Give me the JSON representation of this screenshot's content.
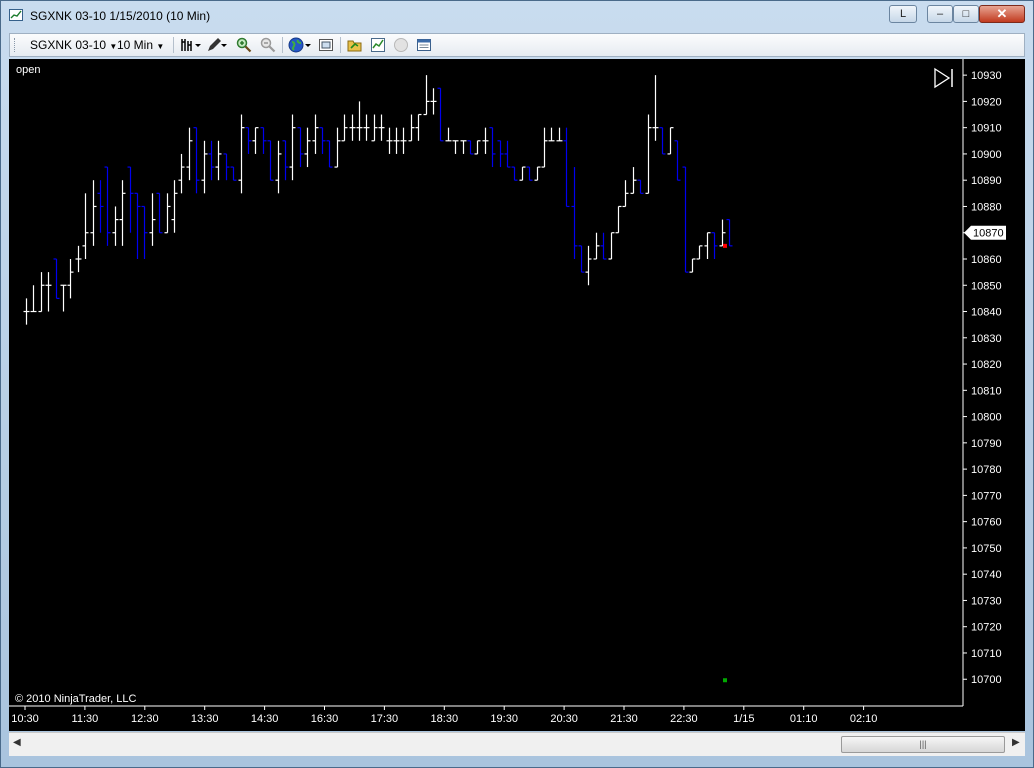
{
  "window": {
    "title": "SGXNK 03-10  1/15/2010 (10 Min)",
    "buttons": {
      "layout": "L",
      "minimize": "–",
      "maximize": "□",
      "close": "✕"
    }
  },
  "toolbar": {
    "instrument": "SGXNK 03-10",
    "interval": "10 Min",
    "icons": [
      "bar-type-icon",
      "drawing-pencil-icon",
      "zoom-in-icon",
      "zoom-out-icon",
      "globe-icon",
      "properties-icon",
      "open-folder-icon",
      "chart-indicators-icon",
      "blank-circle-icon",
      "data-box-icon"
    ]
  },
  "chart": {
    "plot_label": "open",
    "copyright": "© 2010 NinjaTrader, LLC",
    "price_label": "10870",
    "colors": {
      "background": "#000000",
      "up_bar": "#ffffff",
      "down_bar": "#0000ee",
      "marker_red": "#ff0000",
      "marker_green": "#00aa00"
    }
  },
  "chart_data": {
    "type": "ohlc",
    "y_ticks": [
      10930,
      10920,
      10910,
      10900,
      10890,
      10880,
      10870,
      10860,
      10850,
      10840,
      10830,
      10820,
      10810,
      10800,
      10790,
      10780,
      10770,
      10760,
      10750,
      10740,
      10730,
      10720,
      10710,
      10700
    ],
    "ylim": [
      10694,
      10935
    ],
    "x_ticks": [
      "10:30",
      "11:30",
      "12:30",
      "13:30",
      "14:30",
      "16:30",
      "17:30",
      "18:30",
      "19:30",
      "20:30",
      "21:30",
      "22:30",
      "1/15",
      "01:10",
      "02:10"
    ],
    "current_price": 10870,
    "bars": [
      {
        "o": 10840,
        "h": 10845,
        "l": 10835,
        "c": 10840
      },
      {
        "o": 10840,
        "h": 10850,
        "l": 10840,
        "c": 10840
      },
      {
        "o": 10840,
        "h": 10855,
        "l": 10840,
        "c": 10850
      },
      {
        "o": 10850,
        "h": 10855,
        "l": 10840,
        "c": 10850
      },
      {
        "o": 10860,
        "h": 10860,
        "l": 10845,
        "c": 10845
      },
      {
        "o": 10850,
        "h": 10850,
        "l": 10840,
        "c": 10850
      },
      {
        "o": 10850,
        "h": 10860,
        "l": 10845,
        "c": 10855
      },
      {
        "o": 10860,
        "h": 10865,
        "l": 10855,
        "c": 10860
      },
      {
        "o": 10865,
        "h": 10885,
        "l": 10860,
        "c": 10870
      },
      {
        "o": 10870,
        "h": 10890,
        "l": 10865,
        "c": 10880
      },
      {
        "o": 10885,
        "h": 10890,
        "l": 10870,
        "c": 10880
      },
      {
        "o": 10895,
        "h": 10895,
        "l": 10865,
        "c": 10870
      },
      {
        "o": 10870,
        "h": 10880,
        "l": 10865,
        "c": 10875
      },
      {
        "o": 10875,
        "h": 10890,
        "l": 10865,
        "c": 10885
      },
      {
        "o": 10895,
        "h": 10895,
        "l": 10870,
        "c": 10885
      },
      {
        "o": 10885,
        "h": 10885,
        "l": 10860,
        "c": 10880
      },
      {
        "o": 10880,
        "h": 10880,
        "l": 10860,
        "c": 10870
      },
      {
        "o": 10870,
        "h": 10885,
        "l": 10865,
        "c": 10875
      },
      {
        "o": 10885,
        "h": 10885,
        "l": 10870,
        "c": 10870
      },
      {
        "o": 10870,
        "h": 10885,
        "l": 10870,
        "c": 10880
      },
      {
        "o": 10875,
        "h": 10890,
        "l": 10870,
        "c": 10885
      },
      {
        "o": 10890,
        "h": 10900,
        "l": 10885,
        "c": 10895
      },
      {
        "o": 10895,
        "h": 10910,
        "l": 10890,
        "c": 10905
      },
      {
        "o": 10910,
        "h": 10910,
        "l": 10885,
        "c": 10890
      },
      {
        "o": 10890,
        "h": 10905,
        "l": 10885,
        "c": 10900
      },
      {
        "o": 10900,
        "h": 10905,
        "l": 10890,
        "c": 10895
      },
      {
        "o": 10895,
        "h": 10905,
        "l": 10890,
        "c": 10900
      },
      {
        "o": 10900,
        "h": 10900,
        "l": 10890,
        "c": 10895
      },
      {
        "o": 10895,
        "h": 10895,
        "l": 10890,
        "c": 10890
      },
      {
        "o": 10890,
        "h": 10915,
        "l": 10885,
        "c": 10910
      },
      {
        "o": 10910,
        "h": 10910,
        "l": 10900,
        "c": 10905
      },
      {
        "o": 10905,
        "h": 10910,
        "l": 10900,
        "c": 10910
      },
      {
        "o": 10910,
        "h": 10910,
        "l": 10900,
        "c": 10905
      },
      {
        "o": 10905,
        "h": 10905,
        "l": 10890,
        "c": 10890
      },
      {
        "o": 10890,
        "h": 10905,
        "l": 10885,
        "c": 10900
      },
      {
        "o": 10905,
        "h": 10905,
        "l": 10890,
        "c": 10895
      },
      {
        "o": 10895,
        "h": 10915,
        "l": 10890,
        "c": 10910
      },
      {
        "o": 10910,
        "h": 10910,
        "l": 10895,
        "c": 10900
      },
      {
        "o": 10900,
        "h": 10910,
        "l": 10895,
        "c": 10905
      },
      {
        "o": 10905,
        "h": 10915,
        "l": 10900,
        "c": 10910
      },
      {
        "o": 10910,
        "h": 10910,
        "l": 10900,
        "c": 10905
      },
      {
        "o": 10905,
        "h": 10905,
        "l": 10895,
        "c": 10895
      },
      {
        "o": 10895,
        "h": 10910,
        "l": 10895,
        "c": 10905
      },
      {
        "o": 10905,
        "h": 10915,
        "l": 10905,
        "c": 10910
      },
      {
        "o": 10910,
        "h": 10915,
        "l": 10905,
        "c": 10910
      },
      {
        "o": 10910,
        "h": 10920,
        "l": 10905,
        "c": 10910
      },
      {
        "o": 10910,
        "h": 10915,
        "l": 10905,
        "c": 10910
      },
      {
        "o": 10905,
        "h": 10915,
        "l": 10905,
        "c": 10910
      },
      {
        "o": 10910,
        "h": 10915,
        "l": 10905,
        "c": 10910
      },
      {
        "o": 10905,
        "h": 10910,
        "l": 10900,
        "c": 10905
      },
      {
        "o": 10905,
        "h": 10910,
        "l": 10900,
        "c": 10905
      },
      {
        "o": 10905,
        "h": 10910,
        "l": 10900,
        "c": 10905
      },
      {
        "o": 10905,
        "h": 10915,
        "l": 10905,
        "c": 10910
      },
      {
        "o": 10910,
        "h": 10915,
        "l": 10905,
        "c": 10915
      },
      {
        "o": 10915,
        "h": 10930,
        "l": 10915,
        "c": 10920
      },
      {
        "o": 10920,
        "h": 10925,
        "l": 10915,
        "c": 10920
      },
      {
        "o": 10925,
        "h": 10925,
        "l": 10905,
        "c": 10905
      },
      {
        "o": 10905,
        "h": 10910,
        "l": 10905,
        "c": 10905
      },
      {
        "o": 10905,
        "h": 10905,
        "l": 10900,
        "c": 10905
      },
      {
        "o": 10905,
        "h": 10905,
        "l": 10900,
        "c": 10905
      },
      {
        "o": 10905,
        "h": 10905,
        "l": 10900,
        "c": 10900
      },
      {
        "o": 10900,
        "h": 10905,
        "l": 10900,
        "c": 10905
      },
      {
        "o": 10905,
        "h": 10910,
        "l": 10900,
        "c": 10905
      },
      {
        "o": 10910,
        "h": 10910,
        "l": 10895,
        "c": 10900
      },
      {
        "o": 10905,
        "h": 10905,
        "l": 10895,
        "c": 10900
      },
      {
        "o": 10900,
        "h": 10905,
        "l": 10895,
        "c": 10895
      },
      {
        "o": 10895,
        "h": 10895,
        "l": 10890,
        "c": 10890
      },
      {
        "o": 10890,
        "h": 10895,
        "l": 10890,
        "c": 10895
      },
      {
        "o": 10895,
        "h": 10895,
        "l": 10890,
        "c": 10890
      },
      {
        "o": 10890,
        "h": 10895,
        "l": 10890,
        "c": 10895
      },
      {
        "o": 10895,
        "h": 10910,
        "l": 10895,
        "c": 10905
      },
      {
        "o": 10905,
        "h": 10910,
        "l": 10905,
        "c": 10905
      },
      {
        "o": 10905,
        "h": 10910,
        "l": 10905,
        "c": 10905
      },
      {
        "o": 10905,
        "h": 10910,
        "l": 10880,
        "c": 10880
      },
      {
        "o": 10880,
        "h": 10895,
        "l": 10860,
        "c": 10865
      },
      {
        "o": 10865,
        "h": 10865,
        "l": 10855,
        "c": 10855
      },
      {
        "o": 10855,
        "h": 10865,
        "l": 10850,
        "c": 10860
      },
      {
        "o": 10860,
        "h": 10870,
        "l": 10860,
        "c": 10865
      },
      {
        "o": 10865,
        "h": 10870,
        "l": 10860,
        "c": 10860
      },
      {
        "o": 10860,
        "h": 10870,
        "l": 10860,
        "c": 10870
      },
      {
        "o": 10870,
        "h": 10880,
        "l": 10870,
        "c": 10880
      },
      {
        "o": 10880,
        "h": 10890,
        "l": 10880,
        "c": 10885
      },
      {
        "o": 10885,
        "h": 10895,
        "l": 10885,
        "c": 10890
      },
      {
        "o": 10890,
        "h": 10890,
        "l": 10885,
        "c": 10885
      },
      {
        "o": 10885,
        "h": 10915,
        "l": 10885,
        "c": 10910
      },
      {
        "o": 10910,
        "h": 10930,
        "l": 10905,
        "c": 10910
      },
      {
        "o": 10910,
        "h": 10910,
        "l": 10900,
        "c": 10900
      },
      {
        "o": 10900,
        "h": 10910,
        "l": 10900,
        "c": 10910
      },
      {
        "o": 10905,
        "h": 10905,
        "l": 10890,
        "c": 10890
      },
      {
        "o": 10895,
        "h": 10895,
        "l": 10855,
        "c": 10855
      },
      {
        "o": 10855,
        "h": 10860,
        "l": 10855,
        "c": 10860
      },
      {
        "o": 10860,
        "h": 10865,
        "l": 10860,
        "c": 10865
      },
      {
        "o": 10865,
        "h": 10870,
        "l": 10860,
        "c": 10870
      },
      {
        "o": 10870,
        "h": 10870,
        "l": 10860,
        "c": 10865
      },
      {
        "o": 10865,
        "h": 10875,
        "l": 10865,
        "c": 10870
      },
      {
        "o": 10875,
        "h": 10875,
        "l": 10865,
        "c": 10865
      }
    ]
  }
}
